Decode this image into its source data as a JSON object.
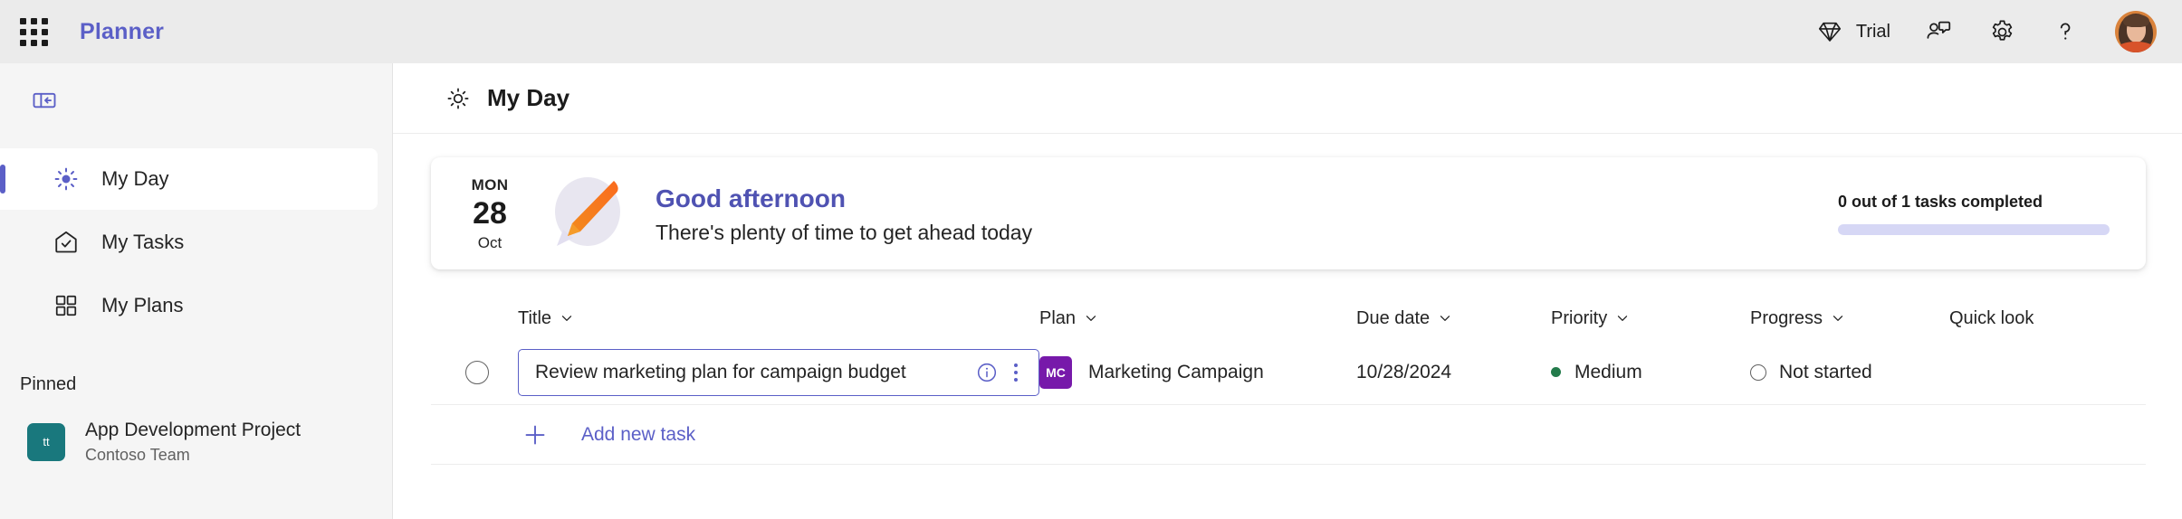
{
  "app": {
    "brand": "Planner",
    "accent_color": "#5B5FC7",
    "topbar_bg": "#EBEBEB"
  },
  "topbar": {
    "app_launcher_icon": "waffle-grid-icon",
    "trial_label": "Trial",
    "trial_icon": "diamond-icon",
    "feedback_icon": "person-feedback-icon",
    "settings_icon": "gear-icon",
    "help_icon": "question-mark-icon",
    "avatar_icon": "user-avatar-photo"
  },
  "sidebar": {
    "collapse_icon": "collapse-panel-icon",
    "items": [
      {
        "label": "My Day",
        "icon": "sun-icon",
        "active": true
      },
      {
        "label": "My Tasks",
        "icon": "tasks-home-check-icon",
        "active": false
      },
      {
        "label": "My Plans",
        "icon": "grid-squares-icon",
        "active": false
      }
    ],
    "section_title": "Pinned",
    "pinned": [
      {
        "initials": "tt",
        "title": "App Development Project",
        "subtitle": "Contoso Team",
        "color": "#19787D"
      }
    ]
  },
  "page": {
    "icon": "sun-icon",
    "title": "My Day"
  },
  "greeting": {
    "date_dow": "MON",
    "date_day": "28",
    "date_month": "Oct",
    "illustration": "pencil-speech-bubble-illustration",
    "title": "Good afternoon",
    "subtitle": "There's plenty of time to get ahead today",
    "progress_label": "0 out of 1 tasks completed",
    "progress_percent": 0
  },
  "table": {
    "columns": [
      {
        "label": "Title",
        "sortable": true
      },
      {
        "label": "Plan",
        "sortable": true
      },
      {
        "label": "Due date",
        "sortable": true
      },
      {
        "label": "Priority",
        "sortable": true
      },
      {
        "label": "Progress",
        "sortable": true
      },
      {
        "label": "Quick look",
        "sortable": false
      }
    ],
    "rows": [
      {
        "completed": false,
        "title": "Review marketing plan for campaign budget",
        "title_placeholder": "Enter a task name",
        "info_icon": "info-circle-icon",
        "more_icon": "more-vertical-icon",
        "plan_initials": "MC",
        "plan_color": "#7719AA",
        "plan_name": "Marketing Campaign",
        "due_date": "10/28/2024",
        "priority": "Medium",
        "priority_color": "#237B4B",
        "progress": "Not started",
        "quick_look": ""
      }
    ],
    "add_row_label": "Add new task",
    "add_row_icon": "plus-icon"
  }
}
